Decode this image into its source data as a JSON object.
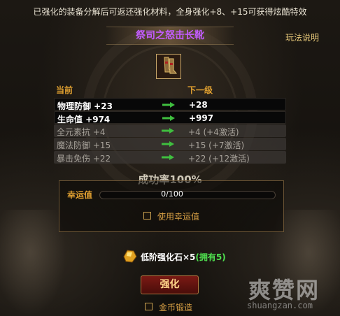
{
  "notice": "已强化的装备分解后可返还强化材料，全身强化+8、+15可获得炫酷特效",
  "item_name": "祭司之怒击长靴",
  "help_link": "玩法说明",
  "columns": {
    "current": "当前",
    "next": "下一级"
  },
  "stats": [
    {
      "current": "物理防御 +23",
      "next": "+28",
      "active": true
    },
    {
      "current": "生命值 +974",
      "next": "+997",
      "active": true
    },
    {
      "current": "全元素抗 +4",
      "next": "+4 (+4激活)",
      "active": false
    },
    {
      "current": "魔法防御 +15",
      "next": "+15 (+7激活)",
      "active": false
    },
    {
      "current": "暴击免伤 +22",
      "next": "+22 (+12激活)",
      "active": false
    }
  ],
  "success_rate": "成功率100%",
  "luck": {
    "label": "幸运值",
    "progress_text": "0/100",
    "value": 0,
    "max": 100
  },
  "use_luck_label": "使用幸运值",
  "material": {
    "name": "低阶强化石×5",
    "owned": "(拥有5)"
  },
  "upgrade_button": "强化",
  "gold_forge_label": "金币锻造",
  "watermark": {
    "title": "爽赞网",
    "url": "shuangzan.com"
  },
  "colors": {
    "item_name": "#c35cff",
    "header": "#e0a030",
    "arrow": "#3fbf3f",
    "owned": "#4fe04f"
  }
}
